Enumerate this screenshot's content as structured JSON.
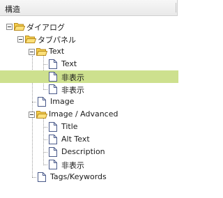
{
  "panel": {
    "title": "構造",
    "tree": [
      {
        "label": "ダイアログ",
        "type": "folder",
        "expanded": true,
        "level": 0
      },
      {
        "label": "タブパネル",
        "type": "folder",
        "expanded": true,
        "level": 1
      },
      {
        "label": "Text",
        "type": "folder",
        "expanded": true,
        "level": 2
      },
      {
        "label": "Text",
        "type": "file",
        "level": 3
      },
      {
        "label": "非表示",
        "type": "file",
        "level": 3,
        "selected": true
      },
      {
        "label": "非表示",
        "type": "file",
        "level": 3
      },
      {
        "label": "Image",
        "type": "file",
        "level": 2
      },
      {
        "label": "Image / Advanced",
        "type": "folder",
        "expanded": true,
        "level": 2
      },
      {
        "label": "Title",
        "type": "file",
        "level": 3
      },
      {
        "label": "Alt Text",
        "type": "file",
        "level": 3
      },
      {
        "label": "Description",
        "type": "file",
        "level": 3
      },
      {
        "label": "非表示",
        "type": "file",
        "level": 3
      },
      {
        "label": "Tags/Keywords",
        "type": "file",
        "level": 2
      }
    ]
  },
  "colors": {
    "selected_row": "#cde08e",
    "folder_fill": "#f3cc4a",
    "file_outline": "#4a5a8a",
    "connector": "#9a9a9a"
  }
}
